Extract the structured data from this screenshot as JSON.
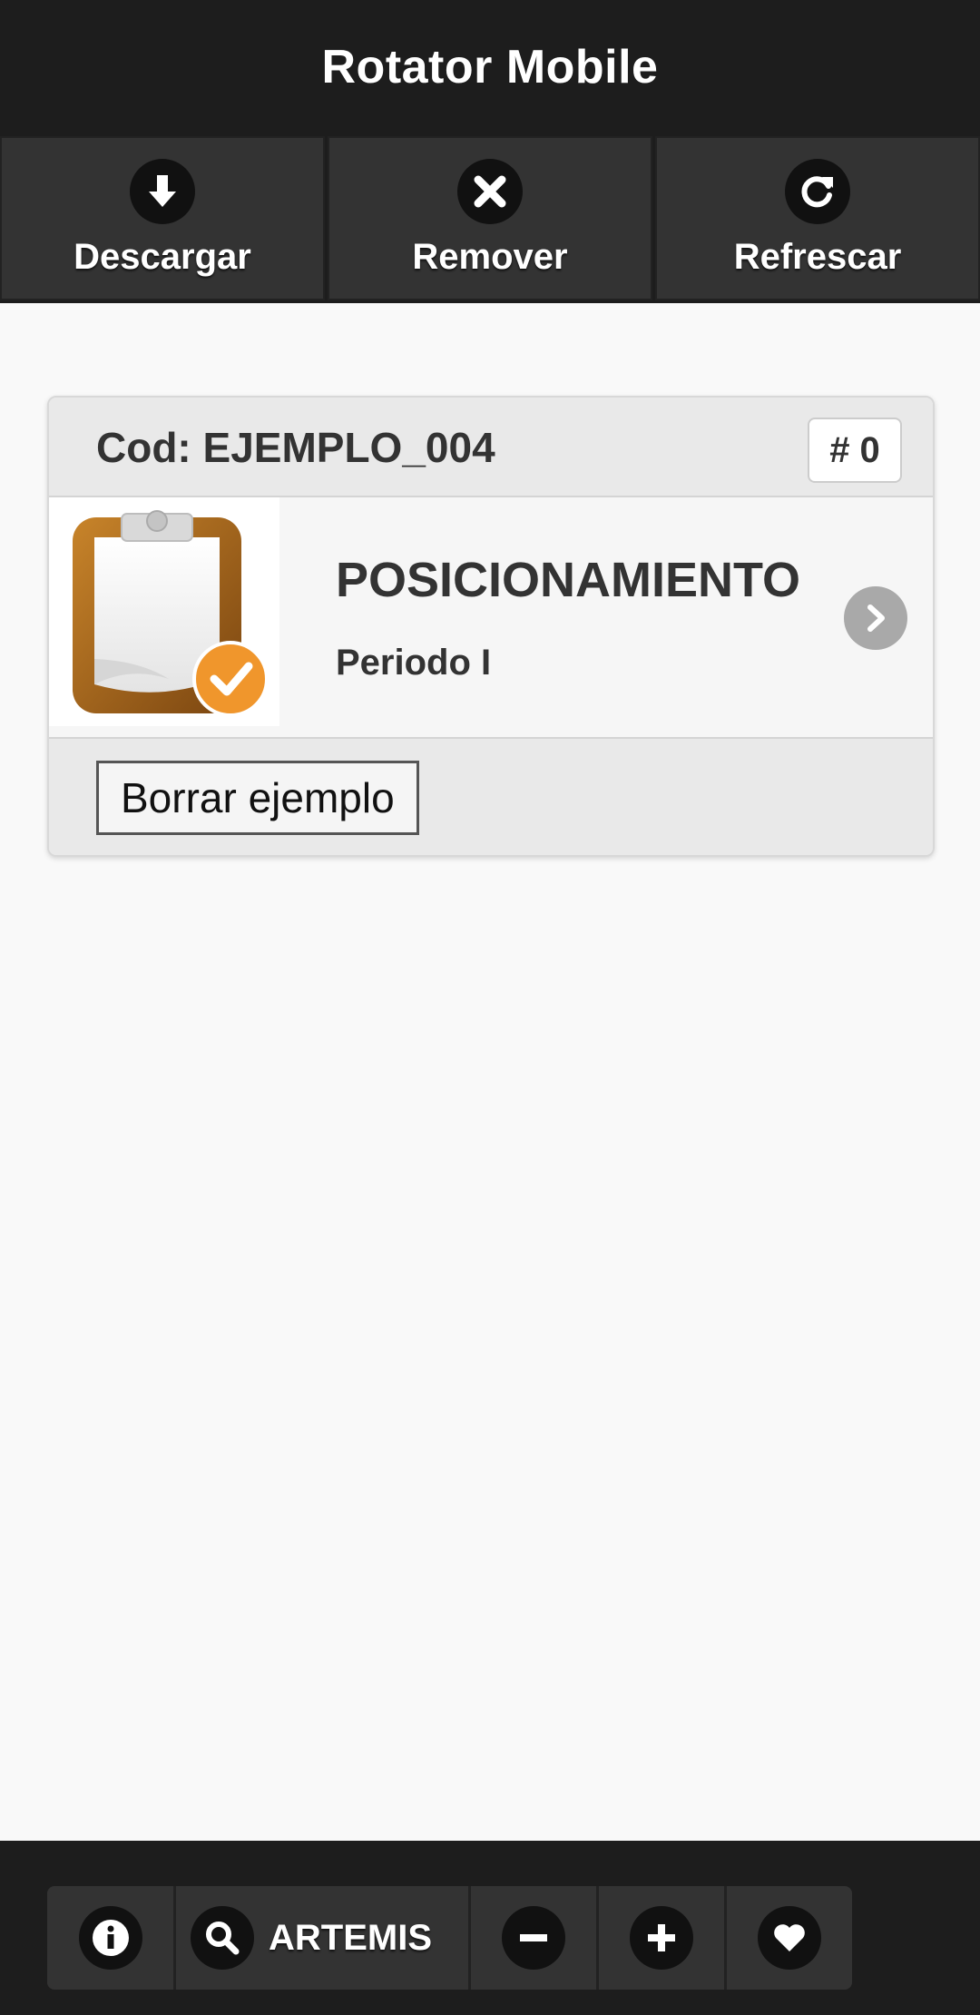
{
  "header": {
    "title": "Rotator Mobile"
  },
  "navbar": {
    "download_label": "Descargar",
    "remove_label": "Remover",
    "refresh_label": "Refrescar"
  },
  "card": {
    "code_label": "Cod: EJEMPLO_004",
    "count_badge": "# 0",
    "title": "POSICIONAMIENTO",
    "subtitle": "Periodo I",
    "delete_button": "Borrar ejemplo"
  },
  "footer": {
    "search_label": "ARTEMIS",
    "icons": [
      "info-icon",
      "search-icon",
      "minus-icon",
      "plus-icon",
      "heart-icon"
    ]
  },
  "colors": {
    "bar_bg": "#1d1d1d",
    "button_bg": "#333333",
    "page_bg": "#f9f9f9",
    "clipboard_brown": "#9a5a16",
    "check_orange": "#f0962c"
  }
}
